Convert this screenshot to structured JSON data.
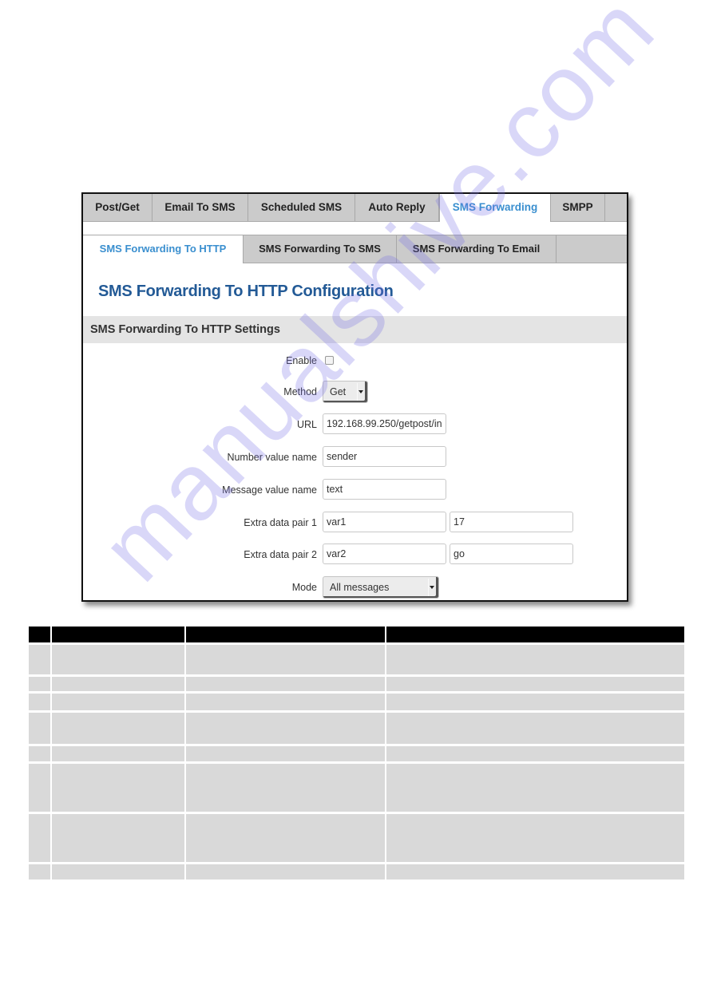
{
  "tabs": [
    {
      "label": "Post/Get",
      "active": false
    },
    {
      "label": "Email To SMS",
      "active": false
    },
    {
      "label": "Scheduled SMS",
      "active": false
    },
    {
      "label": "Auto Reply",
      "active": false
    },
    {
      "label": "SMS Forwarding",
      "active": true
    },
    {
      "label": "SMPP",
      "active": false
    },
    {
      "label": "",
      "active": false
    }
  ],
  "subtabs": [
    {
      "label": "SMS Forwarding To HTTP",
      "active": true
    },
    {
      "label": "SMS Forwarding To SMS",
      "active": false
    },
    {
      "label": "SMS Forwarding To Email",
      "active": false
    },
    {
      "label": "",
      "active": false
    }
  ],
  "page_title": "SMS Forwarding To HTTP Configuration",
  "section_title": "SMS Forwarding To HTTP Settings",
  "form": {
    "enable": {
      "label": "Enable",
      "checked": false
    },
    "method": {
      "label": "Method",
      "value": "Get"
    },
    "url": {
      "label": "URL",
      "value": "192.168.99.250/getpost/in"
    },
    "number_value_name": {
      "label": "Number value name",
      "value": "sender"
    },
    "message_value_name": {
      "label": "Message value name",
      "value": "text"
    },
    "extra_pair_1": {
      "label": "Extra data pair 1",
      "key": "var1",
      "value": "17"
    },
    "extra_pair_2": {
      "label": "Extra data pair 2",
      "key": "var2",
      "value": "go"
    },
    "mode": {
      "label": "Mode",
      "value": "All messages"
    }
  },
  "colors": {
    "accent_tab": "#3a8fcf",
    "title": "#235a96",
    "table_header": "#000000",
    "table_cell": "#d9d9d9",
    "watermark": "#786ee6"
  },
  "table": {
    "columns": 4,
    "header": [
      "",
      "",
      "",
      ""
    ],
    "rows": [
      [
        "",
        "",
        "",
        ""
      ],
      [
        "",
        "",
        "",
        ""
      ],
      [
        "",
        "",
        "",
        ""
      ],
      [
        "",
        "",
        "",
        ""
      ],
      [
        "",
        "",
        "",
        ""
      ],
      [
        "",
        "",
        "",
        ""
      ],
      [
        "",
        "",
        "",
        ""
      ],
      [
        "",
        "",
        "",
        ""
      ]
    ]
  },
  "watermark": "manualshive.com"
}
